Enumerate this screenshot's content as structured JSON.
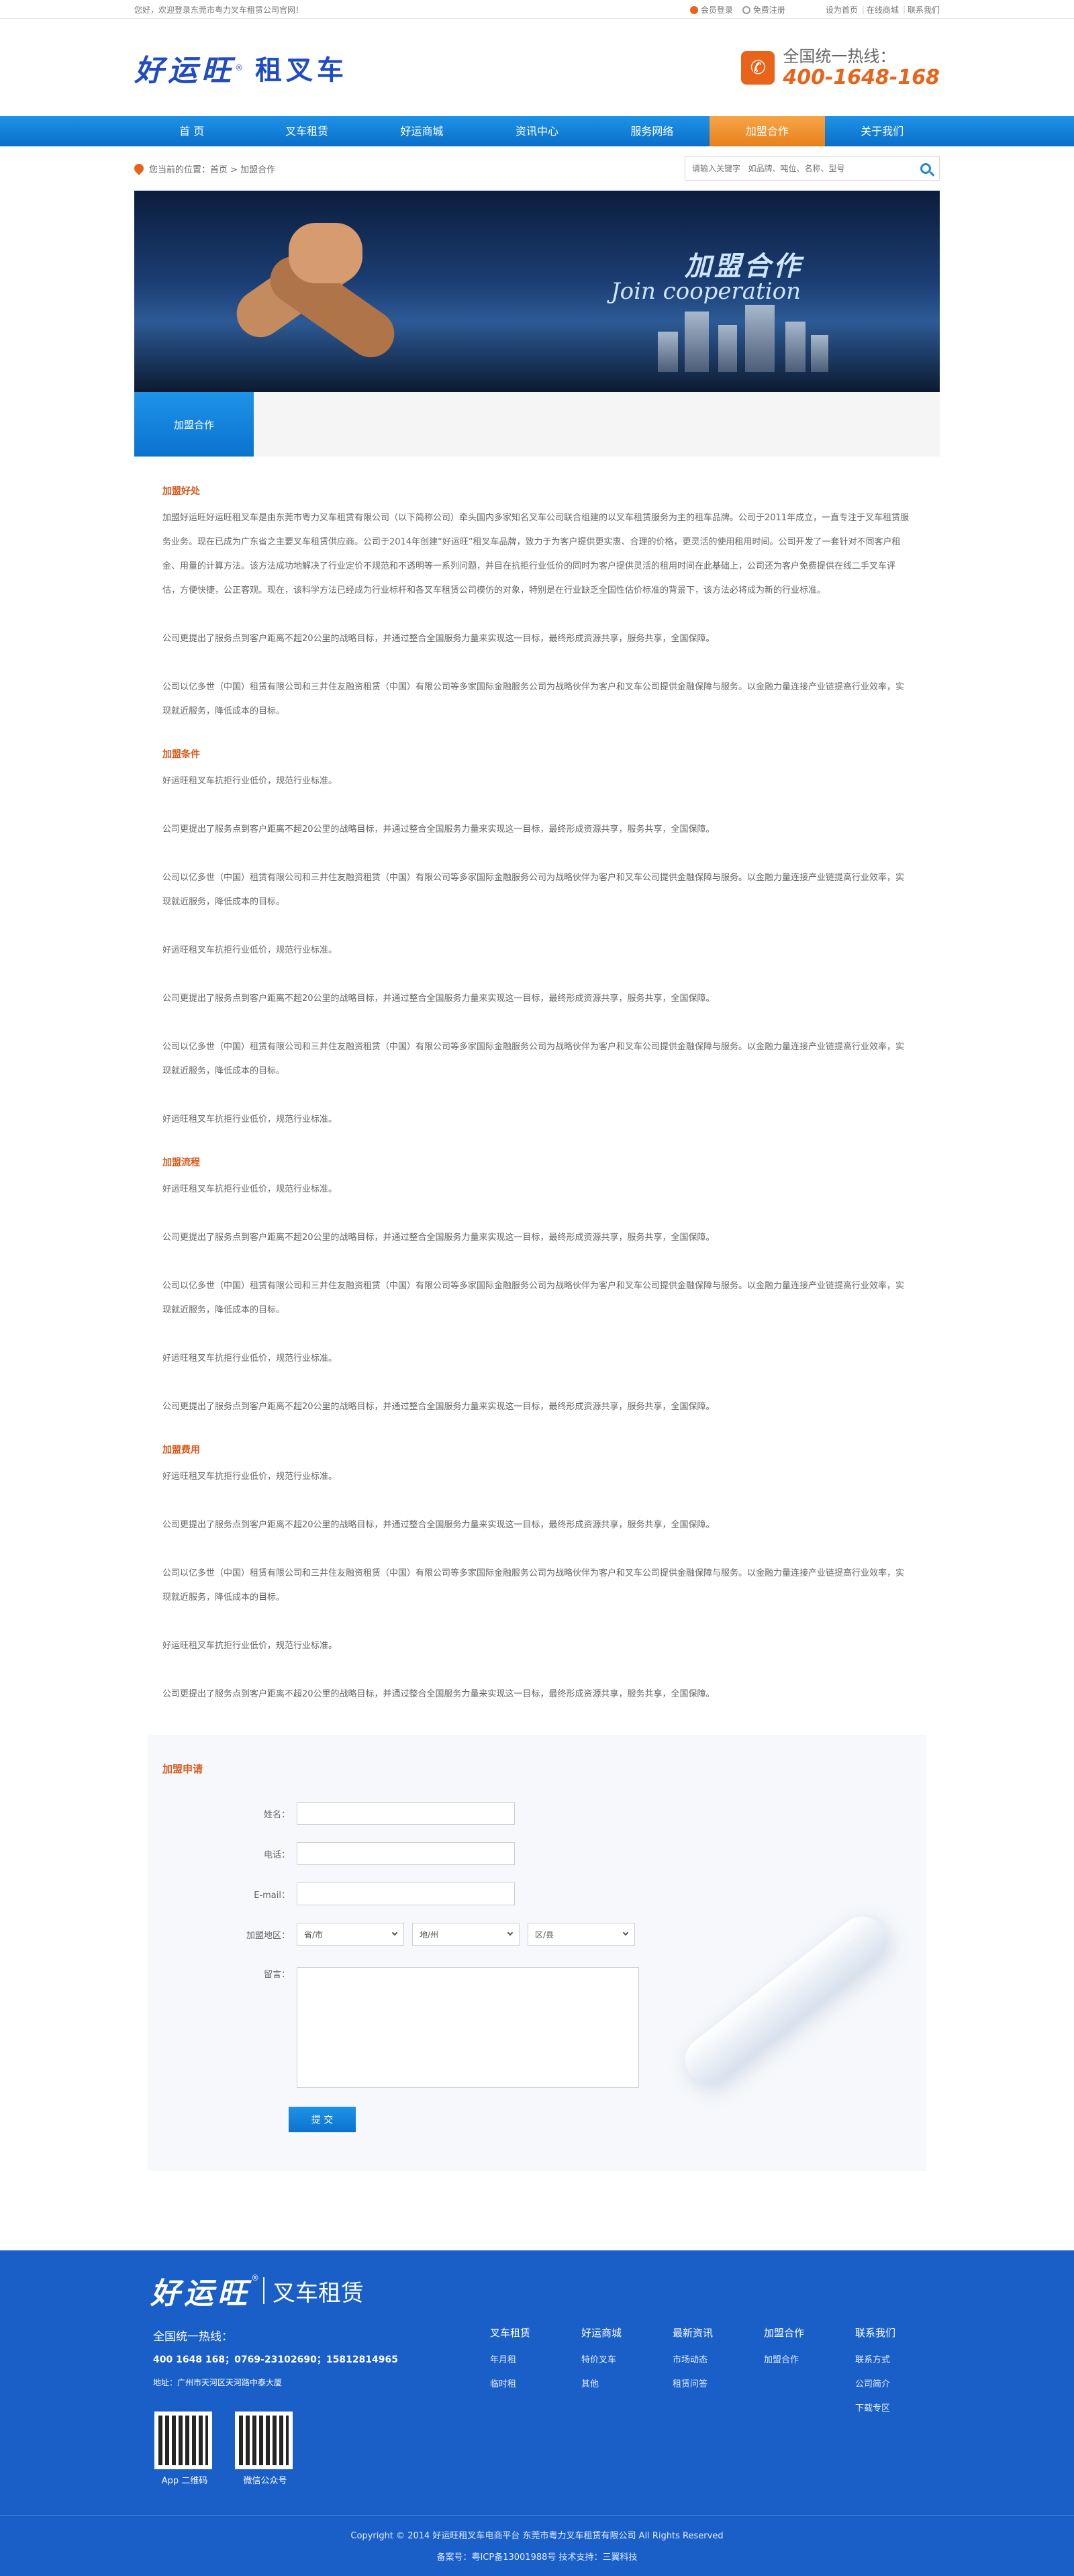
{
  "topbar": {
    "welcome": "您好，欢迎登录东莞市粤力叉车租赁公司官网！",
    "login": "会员登录",
    "register": "免费注册",
    "set_home": "设为首页",
    "online_mall": "在线商城",
    "contact": "联系我们",
    "sep": "|"
  },
  "header": {
    "logo_brand": "好运旺",
    "logo_reg": "®",
    "logo_sub": "租叉车",
    "hotline_label": "全国统一热线：",
    "hotline_number": "400-1648-168",
    "phone_glyph": "✆"
  },
  "nav": {
    "items": [
      "首 页",
      "叉车租赁",
      "好运商城",
      "资讯中心",
      "服务网络",
      "加盟合作",
      "关于我们"
    ],
    "active": "加盟合作"
  },
  "breadcrumb": {
    "text": "您当前的位置：首页 > 加盟合作"
  },
  "search": {
    "placeholder": "请输入关键字   如品牌、吨位、名称、型号"
  },
  "banner": {
    "title_cn": "加盟合作",
    "title_en": "Join cooperation"
  },
  "subtab": {
    "label": "加盟合作"
  },
  "content": {
    "sections": [
      {
        "title": "加盟好处",
        "paragraphs": [
          "加盟好运旺好运旺租叉车是由东莞市粤力叉车租赁有限公司（以下简称公司）牵头国内多家知名叉车公司联合组建的以叉车租赁服务为主的租车品牌。公司于2011年成立，一直专注于叉车租赁服务业务。现在已成为广东省之主要叉车租赁供应商。公司于2014年创建“好运旺”租叉车品牌，致力于为客户提供更实惠、合理的价格，更灵活的使用租用时间。公司开发了一套针对不同客户租金、用量的计算方法。该方法成功地解决了行业定价不规范和不透明等一系列问题，并目在抗拒行业低价的同时为客户提供灵活的租用时间在此基础上，公司还为客户免费提供在线二手叉车评估，方便快捷，公正客观。现在，该科学方法已经成为行业标杆和各叉车租赁公司模仿的对象，特别是在行业缺乏全国性估价标准的背景下，该方法必将成为新的行业标准。",
          "公司更提出了服务点到客户距离不超20公里的战略目标，并通过整合全国服务力量来实现这一目标，最终形成资源共享，服务共享，全国保障。",
          "公司以亿多世（中国）租赁有限公司和三井住友融资租赁（中国）有限公司等多家国际金融服务公司为战略伙伴为客户和叉车公司提供金融保障与服务。以金融力量连接产业链提高行业效率，实现就近服务，降低成本的目标。"
        ]
      },
      {
        "title": "加盟条件",
        "paragraphs": [
          "好运旺租叉车抗拒行业低价，规范行业标准。",
          "公司更提出了服务点到客户距离不超20公里的战略目标，并通过整合全国服务力量来实现这一目标，最终形成资源共享，服务共享，全国保障。",
          "公司以亿多世（中国）租赁有限公司和三井住友融资租赁（中国）有限公司等多家国际金融服务公司为战略伙伴为客户和叉车公司提供金融保障与服务。以金融力量连接产业链提高行业效率，实现就近服务，降低成本的目标。",
          "好运旺租叉车抗拒行业低价，规范行业标准。",
          "公司更提出了服务点到客户距离不超20公里的战略目标，并通过整合全国服务力量来实现这一目标，最终形成资源共享，服务共享，全国保障。",
          "公司以亿多世（中国）租赁有限公司和三井住友融资租赁（中国）有限公司等多家国际金融服务公司为战略伙伴为客户和叉车公司提供金融保障与服务。以金融力量连接产业链提高行业效率，实现就近服务，降低成本的目标。",
          "好运旺租叉车抗拒行业低价，规范行业标准。"
        ]
      },
      {
        "title": "加盟流程",
        "paragraphs": [
          "好运旺租叉车抗拒行业低价，规范行业标准。",
          "公司更提出了服务点到客户距离不超20公里的战略目标，并通过整合全国服务力量来实现这一目标，最终形成资源共享，服务共享，全国保障。",
          "公司以亿多世（中国）租赁有限公司和三井住友融资租赁（中国）有限公司等多家国际金融服务公司为战略伙伴为客户和叉车公司提供金融保障与服务。以金融力量连接产业链提高行业效率，实现就近服务，降低成本的目标。",
          "好运旺租叉车抗拒行业低价，规范行业标准。",
          "公司更提出了服务点到客户距离不超20公里的战略目标，并通过整合全国服务力量来实现这一目标，最终形成资源共享，服务共享，全国保障。"
        ]
      },
      {
        "title": "加盟费用",
        "paragraphs": [
          "好运旺租叉车抗拒行业低价，规范行业标准。",
          "公司更提出了服务点到客户距离不超20公里的战略目标，并通过整合全国服务力量来实现这一目标，最终形成资源共享，服务共享，全国保障。",
          "公司以亿多世（中国）租赁有限公司和三井住友融资租赁（中国）有限公司等多家国际金融服务公司为战略伙伴为客户和叉车公司提供金融保障与服务。以金融力量连接产业链提高行业效率，实现就近服务，降低成本的目标。",
          "好运旺租叉车抗拒行业低价，规范行业标准。",
          "公司更提出了服务点到客户距离不超20公里的战略目标，并通过整合全国服务力量来实现这一目标，最终形成资源共享，服务共享，全国保障。"
        ]
      }
    ]
  },
  "form": {
    "title": "加盟申请",
    "name_label": "姓名：",
    "phone_label": "电话：",
    "email_label": "E-mail：",
    "region_label": "加盟地区：",
    "province": "省/市",
    "city": "地/州",
    "district": "区/县",
    "message_label": "留言：",
    "submit": "提 交"
  },
  "footer": {
    "logo_brand": "好运旺",
    "logo_reg": "®",
    "logo_sub": "叉车租赁",
    "hotline_label": "全国统一热线：",
    "numbers": "400 1648 168；0769-23102690；15812814965",
    "address": "地址：广州市天河区天河路中泰大厦",
    "qr": [
      {
        "label": "App 二维码"
      },
      {
        "label": "微信公众号"
      }
    ],
    "columns": [
      {
        "title": "叉车租赁",
        "items": [
          "年月租",
          "临时租"
        ]
      },
      {
        "title": "好运商城",
        "items": [
          "特价叉车",
          "其他"
        ]
      },
      {
        "title": "最新资讯",
        "items": [
          "市场动态",
          "租赁问答"
        ]
      },
      {
        "title": "加盟合作",
        "items": [
          "加盟合作"
        ]
      },
      {
        "title": "联系我们",
        "items": [
          "联系方式",
          "公司简介",
          "下载专区"
        ]
      }
    ],
    "copyright": "Copyright © 2014 好运旺租叉车电商平台 东莞市粤力叉车租赁有限公司 All Rights Reserved",
    "icp": "备案号：粤ICP备13001988号  技术支持：三翼科技"
  },
  "colors": {
    "brand_blue": "#1f4bc4",
    "nav_blue": "#0a6fc8",
    "accent_orange": "#e8641b",
    "footer_blue": "#1a5fc8"
  }
}
